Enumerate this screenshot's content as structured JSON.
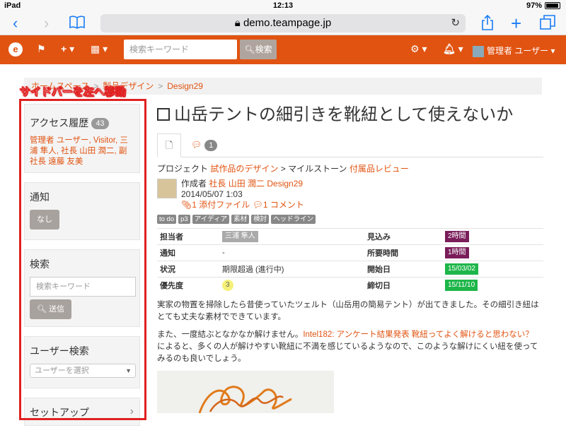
{
  "status": {
    "device": "iPad",
    "time": "12:13",
    "battery": "97%"
  },
  "safari": {
    "url": "demo.teampage.jp"
  },
  "nav": {
    "search_placeholder": "検索キーワード",
    "search_button": "検索",
    "user": "管理者 ユーザー"
  },
  "breadcrumb": {
    "items": [
      "ホームスペース",
      "製品デザイン",
      "Design29"
    ]
  },
  "annotation": {
    "label": "サイドバーを左へ移動"
  },
  "sidebar": {
    "history": {
      "title": "アクセス履歴",
      "count": "43",
      "links": "管理者 ユーザー, Visitor, 三浦 隼人, 社長 山田 潤二, 副社長 遠藤 友美"
    },
    "notify": {
      "title": "通知",
      "button": "なし"
    },
    "search": {
      "title": "検索",
      "placeholder": "検索キーワード",
      "button": "送信"
    },
    "user_search": {
      "title": "ユーザー検索",
      "placeholder": "ユーザーを選択"
    },
    "setup": {
      "title": "セットアップ"
    }
  },
  "main": {
    "title": "山岳テントの細引きを靴紐として使えないか",
    "comment_count": "1",
    "project_label": "プロジェクト",
    "project": "試作品のデザイン",
    "milestone_label": "マイルストーン",
    "milestone": "付属品レビュー",
    "author_label": "作成者",
    "author": "社長 山田 潤二",
    "space": "Design29",
    "date": "2014/05/07 1:03",
    "attachments": "1 添付ファイル",
    "comments": "1 コメント",
    "tags": [
      "to do",
      "p3",
      "アイディア",
      "素材",
      "検討",
      "ヘッドライン"
    ],
    "props": [
      {
        "k1": "担当者",
        "v1": "三浦 隼人",
        "k2": "見込み",
        "v2": "2時間"
      },
      {
        "k1": "通知",
        "v1": "-",
        "k2": "所要時間",
        "v2": "1時間"
      },
      {
        "k1": "状況",
        "v1": "期限超過 (進行中)",
        "k2": "開始日",
        "v2": "15/03/02"
      },
      {
        "k1": "優先度",
        "v1": "3",
        "k2": "締切日",
        "v2": "15/11/10"
      }
    ],
    "para1": "実家の物置を掃除したら昔使っていたツェルト（山岳用の簡易テント）が出てきました。その細引き紐はとても丈夫な素材でできています。",
    "para2_a": "また、一度結ぶとなかなか解けません。",
    "para2_link": "Intel182: アンケート結果発表 靴紐ってよく解けると思わない？",
    "para2_b": "によると、多くの人が解けやすい靴紐に不満を感じているようなので、このような解けにくい紐を使ってみるのも良いでしょう。"
  }
}
